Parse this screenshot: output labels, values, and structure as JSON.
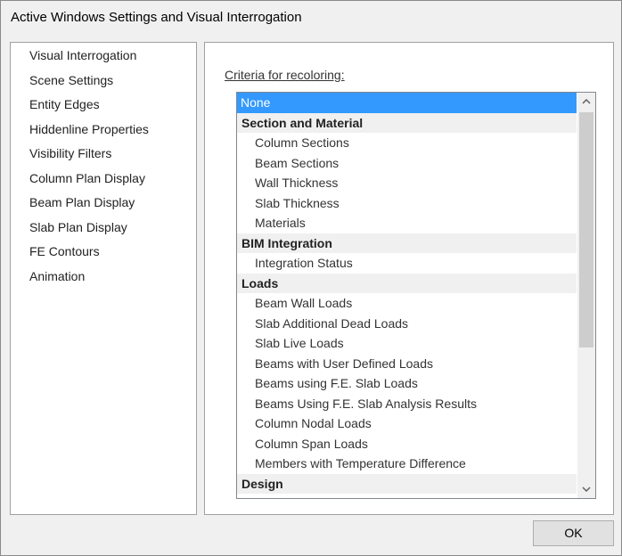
{
  "window": {
    "title": "Active Windows Settings and Visual Interrogation"
  },
  "sidebar": {
    "items": [
      {
        "label": "Visual Interrogation",
        "selected": true
      },
      {
        "label": "Scene Settings"
      },
      {
        "label": "Entity Edges"
      },
      {
        "label": "Hiddenline Properties"
      },
      {
        "label": "Visibility Filters"
      },
      {
        "label": "Column Plan Display"
      },
      {
        "label": "Beam Plan Display"
      },
      {
        "label": "Slab Plan Display"
      },
      {
        "label": "FE Contours"
      },
      {
        "label": "Animation"
      }
    ]
  },
  "main": {
    "criteria_label": "Criteria for recoloring:",
    "list": {
      "rows": [
        {
          "label": "None",
          "type": "item",
          "selected": true
        },
        {
          "label": "Section and Material",
          "type": "group"
        },
        {
          "label": "Column Sections",
          "type": "item"
        },
        {
          "label": "Beam Sections",
          "type": "item"
        },
        {
          "label": "Wall Thickness",
          "type": "item"
        },
        {
          "label": "Slab Thickness",
          "type": "item"
        },
        {
          "label": "Materials",
          "type": "item"
        },
        {
          "label": "BIM Integration",
          "type": "group"
        },
        {
          "label": "Integration Status",
          "type": "item"
        },
        {
          "label": "Loads",
          "type": "group"
        },
        {
          "label": "Beam Wall Loads",
          "type": "item"
        },
        {
          "label": "Slab Additional Dead Loads",
          "type": "item"
        },
        {
          "label": "Slab Live Loads",
          "type": "item"
        },
        {
          "label": "Beams with User Defined Loads",
          "type": "item"
        },
        {
          "label": "Beams using F.E. Slab Loads",
          "type": "item"
        },
        {
          "label": "Beams Using F.E. Slab Analysis Results",
          "type": "item"
        },
        {
          "label": "Column Nodal Loads",
          "type": "item"
        },
        {
          "label": "Column Span Loads",
          "type": "item"
        },
        {
          "label": "Members with Temperature Difference",
          "type": "item"
        },
        {
          "label": "Design",
          "type": "group"
        }
      ],
      "scroll_up_icon": "chevron-up-icon",
      "scroll_down_icon": "chevron-down-icon"
    }
  },
  "footer": {
    "ok_label": "OK"
  },
  "colors": {
    "selection": "#3399ff",
    "group_background": "#f0f0f0"
  }
}
